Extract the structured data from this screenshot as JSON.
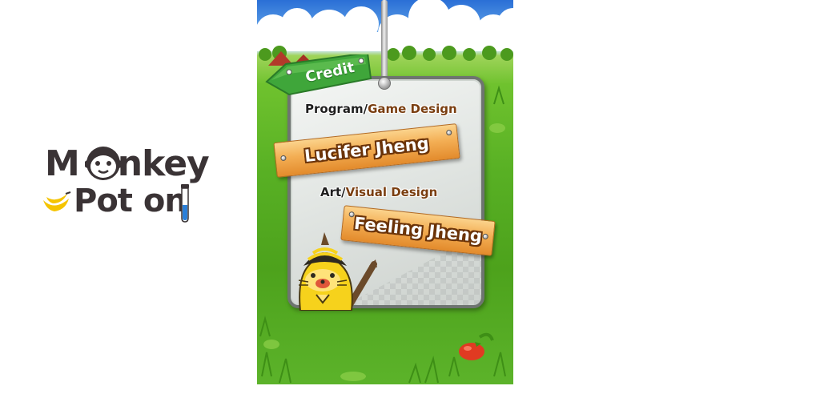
{
  "logo": {
    "line1": "Monkey",
    "line2": "Potion",
    "line1_prefix": "M",
    "line1_suffix": "nkey",
    "line2_prefix": "Pot",
    "line2_suffix": "on"
  },
  "screen": {
    "sign_label": "Credit",
    "credits": [
      {
        "role_part1": "Program/",
        "role_part2": "Game Design",
        "name": "Lucifer Jheng"
      },
      {
        "role_part1": "Art/",
        "role_part2": "Visual Design",
        "name": "Feeling Jheng"
      }
    ]
  },
  "colors": {
    "sign_green": "#3fa63a",
    "plank_orange": "#f3ae54",
    "role_brown": "#7a3e10",
    "logo_dark": "#3a3335",
    "logo_yellow": "#f5c400",
    "tube_blue": "#2b7fd8"
  },
  "icons": [
    "monkey-face-icon",
    "banana-icon",
    "test-tube-icon",
    "mascot-icon",
    "tomato-icon"
  ]
}
